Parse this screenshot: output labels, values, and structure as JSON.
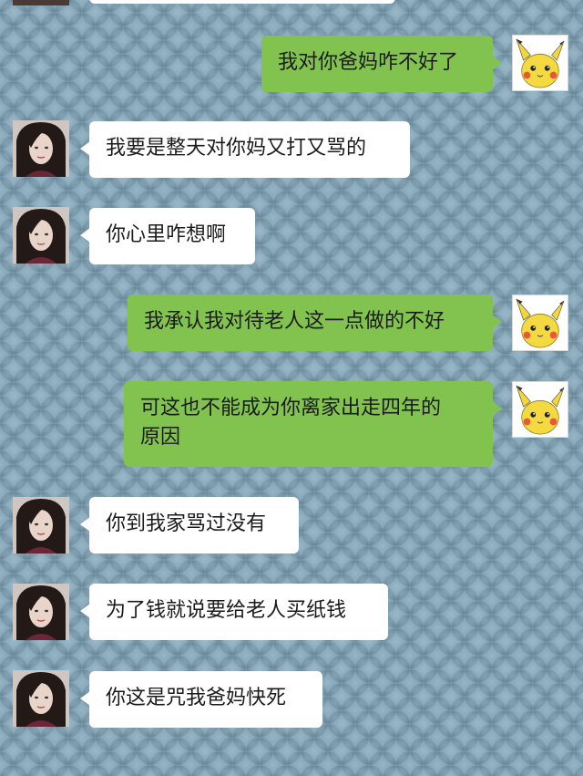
{
  "chat": {
    "colors": {
      "background": "#7fa4b8",
      "incoming_bubble": "#ffffff",
      "outgoing_bubble": "#82c34f",
      "text": "#1b1b1b"
    },
    "messages": [
      {
        "side": "incoming",
        "text": ""
      },
      {
        "side": "outgoing",
        "avatar": "pikachu-avatar",
        "text": "我对你爸妈咋不好了"
      },
      {
        "side": "incoming",
        "avatar": "woman-avatar",
        "text": "我要是整天对你妈又打又骂的"
      },
      {
        "side": "incoming",
        "avatar": "woman-avatar",
        "text": "你心里咋想啊"
      },
      {
        "side": "outgoing",
        "avatar": "pikachu-avatar",
        "text": "我承认我对待老人这一点做的不好"
      },
      {
        "side": "outgoing",
        "avatar": "pikachu-avatar",
        "text": "可这也不能成为你离家出走四年的\n原因"
      },
      {
        "side": "incoming",
        "avatar": "woman-avatar",
        "text": "你到我家骂过没有"
      },
      {
        "side": "incoming",
        "avatar": "woman-avatar",
        "text": "为了钱就说要给老人买纸钱"
      },
      {
        "side": "incoming",
        "avatar": "woman-avatar",
        "text": "你这是咒我爸妈快死"
      }
    ]
  }
}
